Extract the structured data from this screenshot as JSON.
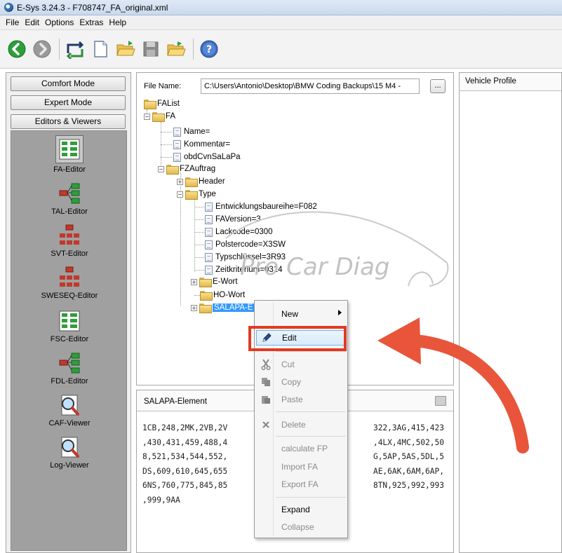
{
  "window": {
    "title": "E-Sys 3.24.3 - F708747_FA_original.xml"
  },
  "menubar": {
    "items": [
      "File",
      "Edit",
      "Options",
      "Extras",
      "Help"
    ]
  },
  "toolbar": {
    "icons": [
      "back-icon",
      "forward-icon",
      "connect-icon",
      "new-file-icon",
      "open-folder-icon",
      "save-icon",
      "open-folder-2-icon",
      "help-icon"
    ]
  },
  "modes": {
    "comfort": "Comfort Mode",
    "expert": "Expert Mode",
    "editors": "Editors & Viewers"
  },
  "editors": [
    {
      "label": "FA-Editor"
    },
    {
      "label": "TAL-Editor"
    },
    {
      "label": "SVT-Editor"
    },
    {
      "label": "SWESEQ-Editor"
    },
    {
      "label": "FSC-Editor"
    },
    {
      "label": "FDL-Editor"
    },
    {
      "label": "CAF-Viewer"
    },
    {
      "label": "Log-Viewer"
    }
  ],
  "fa": {
    "file_label": "File Name:",
    "file_value": "C:\\Users\\Antonio\\Desktop\\BMW Coding Backups\\15 M4 -",
    "browse_label": "...",
    "tree": {
      "falist": "FAList",
      "fa": "FA",
      "name": "Name=",
      "kommentar": "Kommentar=",
      "obd": "obdCvnSaLaPa",
      "fzauftrag": "FZAuftrag",
      "header": "Header",
      "type": "Type",
      "entw": "Entwicklungsbaureihe=F082",
      "faversion": "FAVersion=3",
      "lackcode": "Lackcode=0300",
      "polster": "Polstercode=X3SW",
      "typschl": "Typschlüssel=3R93",
      "zeit": "Zeitkriterium=0314",
      "ewort": "E-Wort",
      "howort": "HO-Wort",
      "salapa": "SALAPA-E"
    }
  },
  "watermark": {
    "text": "Pro Car Diag"
  },
  "salapa_panel": {
    "title": "SALAPA-Element",
    "lines": [
      "1CB,248,2MK,2VB,2V",
      "322,3AG,415,423",
      ",430,431,459,488,4",
      ",4LX,4MC,502,50",
      "8,521,534,544,552,",
      "G,5AP,5AS,5DL,5",
      "DS,609,610,645,655",
      "AE,6AK,6AM,6AP,",
      "6NS,760,775,845,85",
      "8TN,925,992,993",
      ",999,9AA"
    ]
  },
  "vehicle_profile": {
    "title": "Vehicle Profile"
  },
  "context_menu": {
    "new": "New",
    "edit": "Edit",
    "cut": "Cut",
    "copy": "Copy",
    "paste": "Paste",
    "delete": "Delete",
    "calculate": "calculate FP",
    "import": "Import FA",
    "export": "Export FA",
    "expand": "Expand",
    "collapse": "Collapse"
  },
  "colors": {
    "selection": "#3399ff",
    "annotation_red": "#e23a22"
  }
}
